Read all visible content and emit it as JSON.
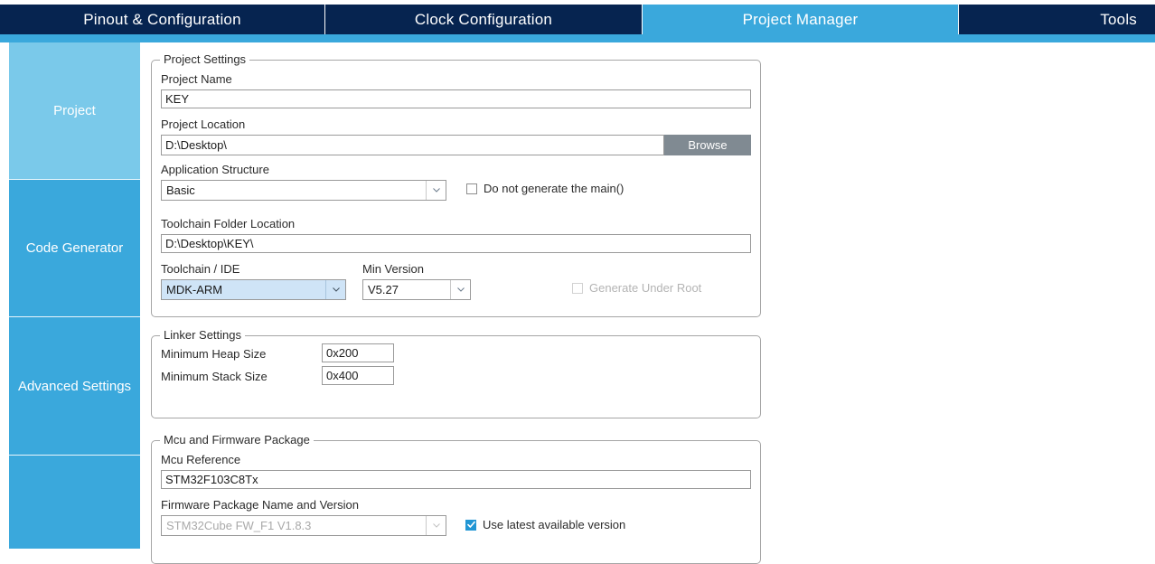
{
  "app": {
    "name": "STM32CubeMX",
    "accent_active_tab": "#3aa8dc",
    "accent_tab_bar": "#062450",
    "accent_sidebar": "#3aa8dc",
    "accent_sidebar_active": "#7ac9ea",
    "accent_checkbox_checked": "#2196d4",
    "accent_button": "#808a92"
  },
  "tabs": [
    {
      "label": "Pinout & Configuration",
      "active": false
    },
    {
      "label": "Clock Configuration",
      "active": false
    },
    {
      "label": "Project Manager",
      "active": true
    },
    {
      "label": "Tools",
      "active": false
    }
  ],
  "sidebar": {
    "items": [
      {
        "label": "Project",
        "active": true
      },
      {
        "label": "Code Generator",
        "active": false
      },
      {
        "label": "Advanced Settings",
        "active": false
      },
      {
        "label": "",
        "active": false
      }
    ]
  },
  "project_settings": {
    "title": "Project Settings",
    "project_name_label": "Project Name",
    "project_name_value": "KEY",
    "project_location_label": "Project Location",
    "project_location_value": "D:\\Desktop\\",
    "browse_label": "Browse",
    "application_structure_label": "Application Structure",
    "application_structure_value": "Basic",
    "do_not_generate_main_label": "Do not generate the main()",
    "do_not_generate_main_checked": false,
    "toolchain_folder_label": "Toolchain Folder Location",
    "toolchain_folder_value": "D:\\Desktop\\KEY\\",
    "toolchain_ide_label": "Toolchain / IDE",
    "toolchain_ide_value": "MDK-ARM",
    "min_version_label": "Min Version",
    "min_version_value": "V5.27",
    "generate_under_root_label": "Generate Under Root",
    "generate_under_root_checked": false,
    "generate_under_root_disabled": true
  },
  "linker_settings": {
    "title": "Linker Settings",
    "min_heap_label": "Minimum Heap Size",
    "min_heap_value": "0x200",
    "min_stack_label": "Minimum Stack Size",
    "min_stack_value": "0x400"
  },
  "mcu_firmware": {
    "title": "Mcu and Firmware Package",
    "mcu_reference_label": "Mcu Reference",
    "mcu_reference_value": "STM32F103C8Tx",
    "firmware_package_label": "Firmware Package Name and Version",
    "firmware_package_value": "STM32Cube FW_F1 V1.8.3",
    "firmware_package_disabled": true,
    "use_latest_label": "Use latest available version",
    "use_latest_checked": true
  }
}
